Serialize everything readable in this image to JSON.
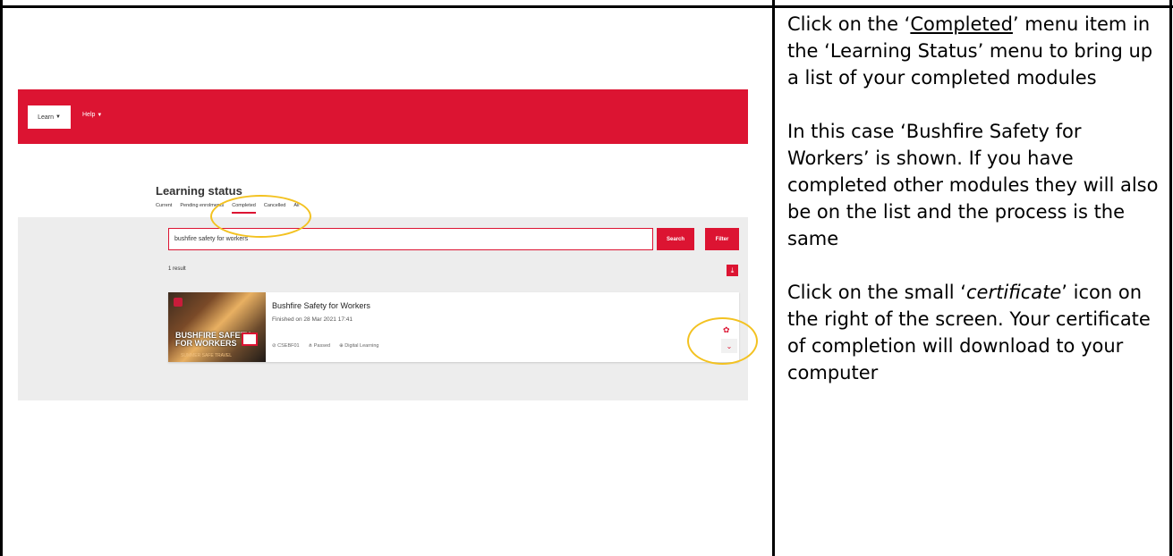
{
  "app": {
    "nav": {
      "learn_label": "Learn",
      "help_label": "Help"
    },
    "page_title": "Learning status",
    "tabs": [
      "Current",
      "Pending enrolments",
      "Completed",
      "Cancelled",
      "All"
    ],
    "search": {
      "value": "bushfire safety for workers",
      "button_label": "Search"
    },
    "filter_label": "Filter",
    "result_count": "1 result",
    "course": {
      "thumbnail_title": "BUSHFIRE SAFETY FOR WORKERS",
      "thumbnail_subtitle": "SUMMER SAFE TRAVEL",
      "title": "Bushfire Safety for Workers",
      "finished": "Finished on 28 Mar 2021 17:41",
      "code": "CSEBF01",
      "status": "Passed",
      "type": "Digital Learning"
    },
    "colors": {
      "brand": "#dc1432",
      "highlight": "#f3c221"
    }
  },
  "instructions": {
    "p1_a": "Click on the ‘",
    "p1_link": "Completed",
    "p1_b": "’ menu item in the ‘Learning Status’ menu to bring up a list of your completed modules",
    "p2": "In this case ‘Bushfire Safety for Workers’ is shown. If you have completed other modules they will also be on the list and the process is the same",
    "p3_a": "Click on the small ‘",
    "p3_em": "certificate",
    "p3_b": "’ icon on the right of the screen. Your certificate of completion will download to your computer"
  }
}
